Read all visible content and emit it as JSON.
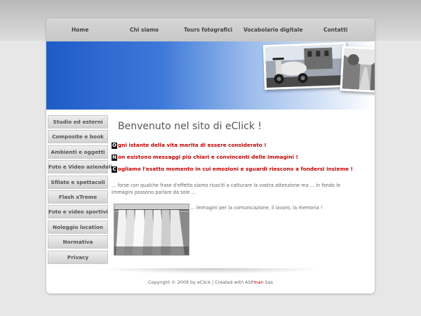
{
  "nav": {
    "items": [
      "Home",
      "Chi siamo",
      "Tours fotografici",
      "Vocabolario digitale",
      "Contatti"
    ]
  },
  "sidebar": {
    "items": [
      "Studio ed esterni",
      "Composite e book",
      "Ambienti e oggetti",
      "Foto e Video aziendali",
      "Sfilate e spettacoli",
      "Flash xTreme",
      "Foto e video sportivi",
      "Noleggio location",
      "Normativa",
      "Privacy"
    ]
  },
  "main": {
    "title": "Benvenuto nel sito di eClick !",
    "quotes": [
      {
        "initial": "O",
        "text": "gni istante della vita merita di essere considerato !"
      },
      {
        "initial": "N",
        "text": "on esistono messaggi più chiari e convincenti delle immagini !"
      },
      {
        "initial": "C",
        "text": "ogliamo l'esatto momento in cui emozioni e sguardi riescono a fondersi insieme !"
      }
    ],
    "intro": "... forse con qualche frase d'effetto siamo riusciti a catturare la vostra attenzione ma ... in fondo le immagini possono parlare da sole ...",
    "tagline": "... immagini per la comunicazione, il lavoro, la memoria !"
  },
  "footer": {
    "prefix": "Copyright © 2009 by eClick | Created with ASP",
    "accent": "man",
    "suffix": " Sas"
  },
  "colors": {
    "accent": "#c00000",
    "banner_blue": "#1f5bc7",
    "background": "#e7e7e7"
  }
}
